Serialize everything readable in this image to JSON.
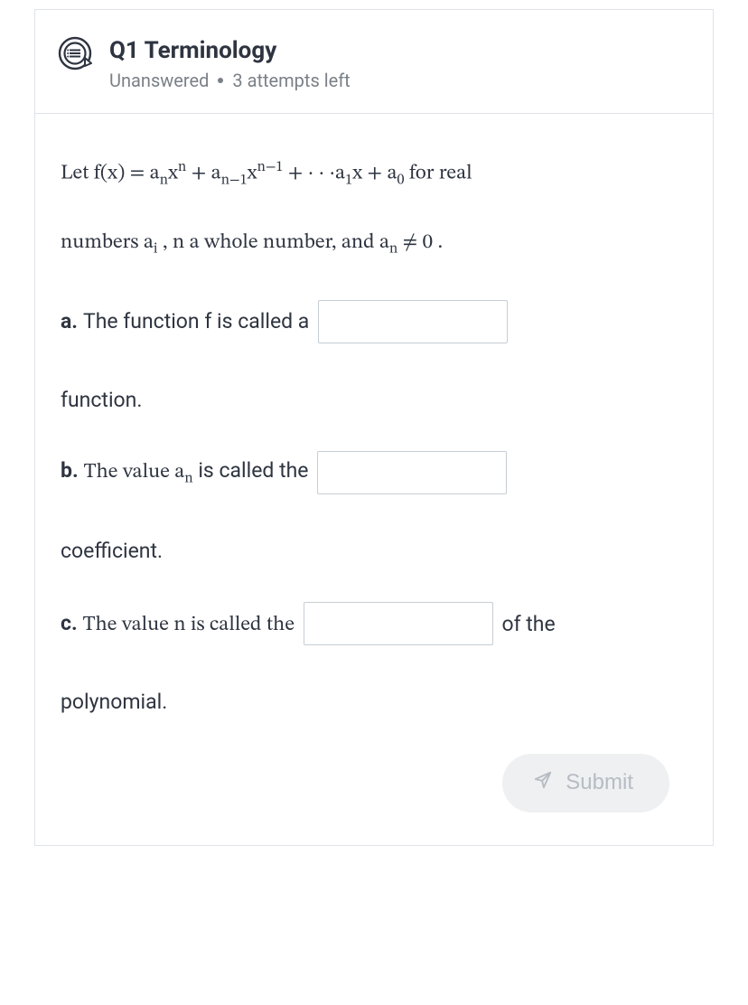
{
  "header": {
    "title": "Q1 Terminology",
    "status_unanswered": "Unanswered",
    "status_attempts": "3 attempts left"
  },
  "intro": {
    "line1_prefix": "Let ",
    "line1_fx": "f(x) = a",
    "line1_sub_n": "n",
    "line1_xn": "x",
    "line1_sup_n": "n",
    "line1_plus1": " + a",
    "line1_sub_nm1": "n−1",
    "line1_x2": "x",
    "line1_sup_nm1": "n−1",
    "line1_dots": " + · · ·a",
    "line1_sub_1": "1",
    "line1_xplus": "x + a",
    "line1_sub_0": "0",
    "line1_tail": " for real",
    "line2_pre": "numbers a",
    "line2_sub_i": "i",
    "line2_mid": " , n a whole number, and a",
    "line2_sub_n": "n",
    "line2_ne": " ≠ 0 ."
  },
  "parts": {
    "a": {
      "label": "a.",
      "pre": "The function f is called a",
      "post": "function."
    },
    "b": {
      "label": "b.",
      "pre_1": "The value a",
      "pre_sub": "n",
      "pre_2": " is called the",
      "post": "coefficient."
    },
    "c": {
      "label": "c.",
      "pre": "The value n is called the",
      "mid": "of the",
      "post": "polynomial."
    }
  },
  "submit": {
    "label": "Submit"
  }
}
